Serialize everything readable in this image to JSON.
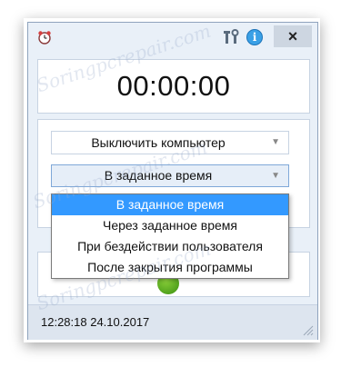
{
  "titlebar": {
    "app_icon": "alarm-clock-icon",
    "tools_icon": "tools-icon",
    "info_icon": "info-icon",
    "info_glyph": "i",
    "close_label": "×"
  },
  "timer": {
    "display": "00:00:00"
  },
  "action_select": {
    "value": "Выключить компьютер"
  },
  "mode_select": {
    "value": "В заданное время",
    "options": [
      "В заданное время",
      "Через заданное время",
      "При бездействии пользователя",
      "После закрытия программы"
    ],
    "selected_index": 0
  },
  "start_button": {
    "icon": "green-start-icon"
  },
  "statusbar": {
    "datetime": "12:28:18  24.10.2017"
  },
  "watermark": "Soringpcrepair.com",
  "colors": {
    "window_bg": "#e9f0f8",
    "selected_item": "#3399ff",
    "border": "#c7d3e2"
  }
}
